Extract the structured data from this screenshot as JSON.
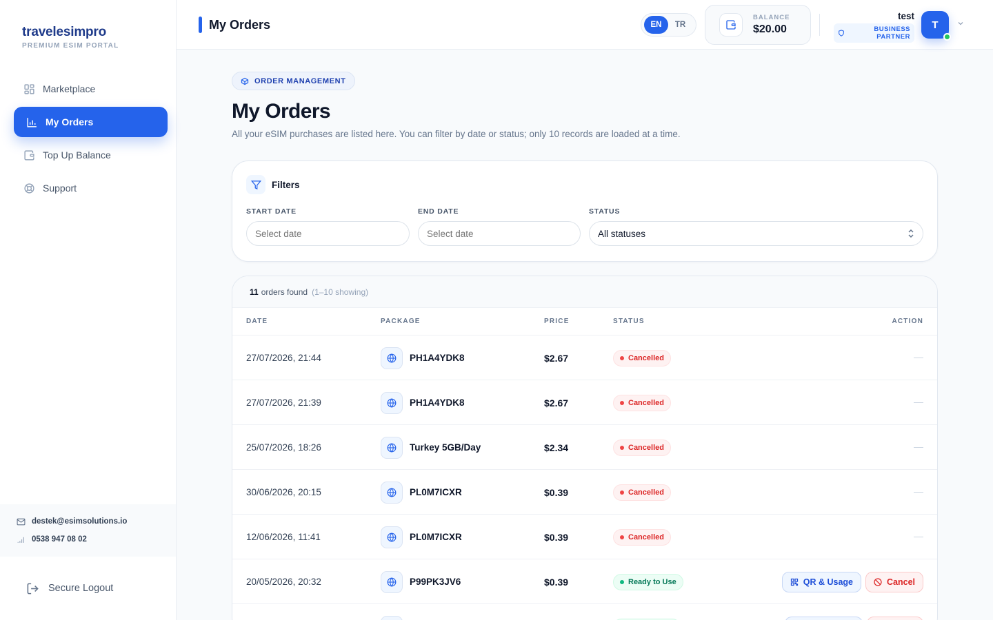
{
  "brand": {
    "name": "travelesimpro",
    "subtitle": "PREMIUM ESIM PORTAL"
  },
  "sidebar": {
    "items": [
      {
        "label": "Marketplace",
        "icon": "grid-icon",
        "active": false
      },
      {
        "label": "My Orders",
        "icon": "bar-chart-icon",
        "active": true
      },
      {
        "label": "Top Up Balance",
        "icon": "wallet-icon",
        "active": false
      },
      {
        "label": "Support",
        "icon": "lifebuoy-icon",
        "active": false
      }
    ],
    "contact": {
      "email": "destek@esimsolutions.io",
      "phone": "0538 947 08 02"
    },
    "logout_label": "Secure Logout"
  },
  "topbar": {
    "title": "My Orders",
    "languages": [
      "EN",
      "TR"
    ],
    "active_language": "EN",
    "balance_label": "BALANCE",
    "balance_value": "$20.00",
    "user_name": "test",
    "user_badge": "BUSINESS PARTNER",
    "avatar_initial": "T"
  },
  "page": {
    "badge": "ORDER MANAGEMENT",
    "title": "My Orders",
    "description": "All your eSIM purchases are listed here. You can filter by date or status; only 10 records are loaded at a time."
  },
  "filters": {
    "title": "Filters",
    "start_label": "START DATE",
    "start_placeholder": "Select date",
    "end_label": "END DATE",
    "end_placeholder": "Select date",
    "status_label": "STATUS",
    "status_value": "All statuses"
  },
  "orders": {
    "count": "11",
    "count_text": "orders found",
    "showing": "(1–10 showing)",
    "columns": {
      "date": "DATE",
      "package": "PACKAGE",
      "price": "PRICE",
      "status": "STATUS",
      "action": "ACTION"
    },
    "qr_label": "QR & Usage",
    "cancel_label": "Cancel",
    "rows": [
      {
        "date": "27/07/2026, 21:44",
        "package": "PH1A4YDK8",
        "price": "$2.67",
        "status": "Cancelled"
      },
      {
        "date": "27/07/2026, 21:39",
        "package": "PH1A4YDK8",
        "price": "$2.67",
        "status": "Cancelled"
      },
      {
        "date": "25/07/2026, 18:26",
        "package": "Turkey 5GB/Day",
        "price": "$2.34",
        "status": "Cancelled"
      },
      {
        "date": "30/06/2026, 20:15",
        "package": "PL0M7ICXR",
        "price": "$0.39",
        "status": "Cancelled"
      },
      {
        "date": "12/06/2026, 11:41",
        "package": "PL0M7ICXR",
        "price": "$0.39",
        "status": "Cancelled"
      },
      {
        "date": "20/05/2026, 20:32",
        "package": "P99PK3JV6",
        "price": "$0.39",
        "status": "Ready to Use"
      }
    ]
  },
  "colors": {
    "accent": "#2563eb",
    "cancelled": "#dc2626",
    "ready": "#047857"
  }
}
